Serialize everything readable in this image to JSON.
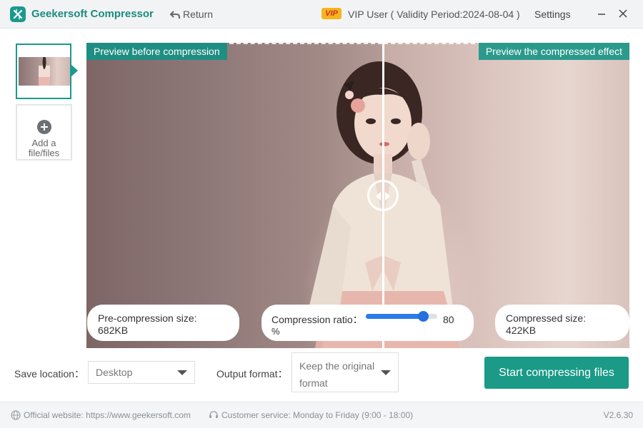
{
  "titlebar": {
    "app_name": "Geekersoft Compressor",
    "return_label": "Return",
    "vip_badge": "VIP",
    "vip_text": "VIP User ( Validity Period:2024-08-04 )",
    "settings_label": "Settings"
  },
  "sidebar": {
    "add_label": "Add a file/files"
  },
  "preview": {
    "before_label": "Preview before compression",
    "after_label": "Preview the compressed effect",
    "pre_size_label": "Pre-compression size:",
    "pre_size_value": "682KB",
    "ratio_label": "Compression ratio：",
    "ratio_value": "80",
    "ratio_unit": "%",
    "ratio_slider_fraction": 0.8,
    "post_size_label": "Compressed size:",
    "post_size_value": "422KB"
  },
  "controls": {
    "save_location_label": "Save location：",
    "save_location_value": "Desktop",
    "output_format_label": "Output format：",
    "output_format_value": "Keep the original format",
    "start_button": "Start compressing files"
  },
  "footer": {
    "website": "Official website: https://www.geekersoft.com",
    "service": "Customer service: Monday to Friday (9:00 - 18:00)",
    "version": "V2.6.30"
  },
  "colors": {
    "accent": "#1a9a8d",
    "slider": "#2d7be6",
    "vip": "#f6b41e"
  },
  "icons": [
    "logo-icon",
    "return-arrow-icon",
    "vip-badge",
    "minimize-icon",
    "close-icon",
    "add-icon",
    "globe-icon",
    "headset-icon",
    "compare-handle-icon",
    "chevron-down-icon"
  ]
}
